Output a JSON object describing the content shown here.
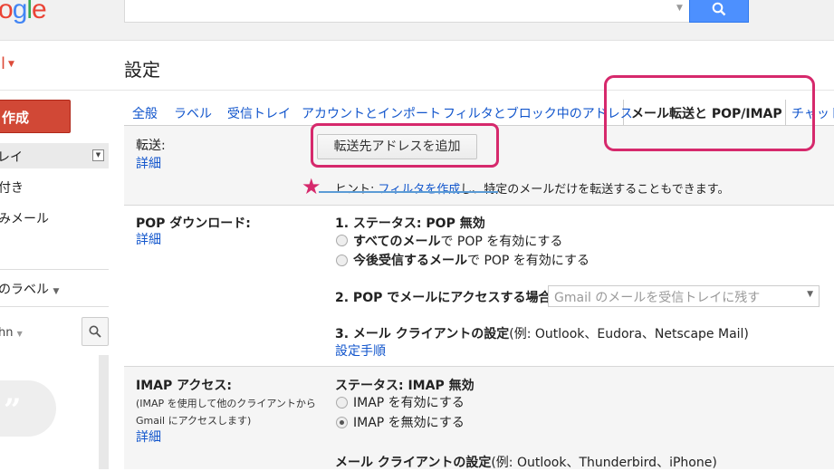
{
  "header": {
    "logo_text": "ogle",
    "search_placeholder": ""
  },
  "app_menu": {
    "label": "il"
  },
  "page_title": "設定",
  "sidebar": {
    "compose": "作成",
    "items": [
      "レイ",
      "付き",
      "みメール"
    ],
    "labels_more": "のラベル",
    "user": "hn"
  },
  "tabs": [
    {
      "label": "全般"
    },
    {
      "label": "ラベル"
    },
    {
      "label": "受信トレイ"
    },
    {
      "label": "アカウントとインポート"
    },
    {
      "label": "フィルタとブロック中のアドレス"
    },
    {
      "label": "メール転送と POP/IMAP",
      "active": true
    },
    {
      "label": "チャット"
    }
  ],
  "forwarding": {
    "label": "転送:",
    "details": "詳細",
    "add_button": "転送先アドレスを追加",
    "hint_prefix": "ヒント: ",
    "hint_link": "フィルタを作成",
    "hint_suffix": "し、特定のメールだけを転送することもできます。"
  },
  "pop": {
    "label": "POP ダウンロード:",
    "details": "詳細",
    "status": "1. ステータス: POP 無効",
    "option1_bold": "すべてのメール",
    "option1_rest": "で POP を有効にする",
    "option2_bold": "今後受信するメール",
    "option2_rest": "で POP を有効にする",
    "access_label": "2. POP でメールにアクセスする場合",
    "access_value": "Gmail のメールを受信トレイに残す",
    "client_label_bold": "3. メール クライアントの設定",
    "client_label_rest": "(例: Outlook、Eudora、Netscape Mail)",
    "setup_link": "設定手順"
  },
  "imap": {
    "label": "IMAP アクセス:",
    "note1": "(IMAP を使用して他のクライアントから",
    "note2": "Gmail にアクセスします)",
    "details": "詳細",
    "status": "ステータス: IMAP 無効",
    "option_enable": "IMAP を有効にする",
    "option_disable": "IMAP を無効にする",
    "selected": "disable",
    "client_label_bold": "メール クライアントの設定",
    "client_label_rest": "(例: Outlook、Thunderbird、iPhone)"
  },
  "colors": {
    "link": "#1155cc",
    "compose": "#d14836",
    "annotation": "#d6296c",
    "search_button": "#4d90fe"
  }
}
